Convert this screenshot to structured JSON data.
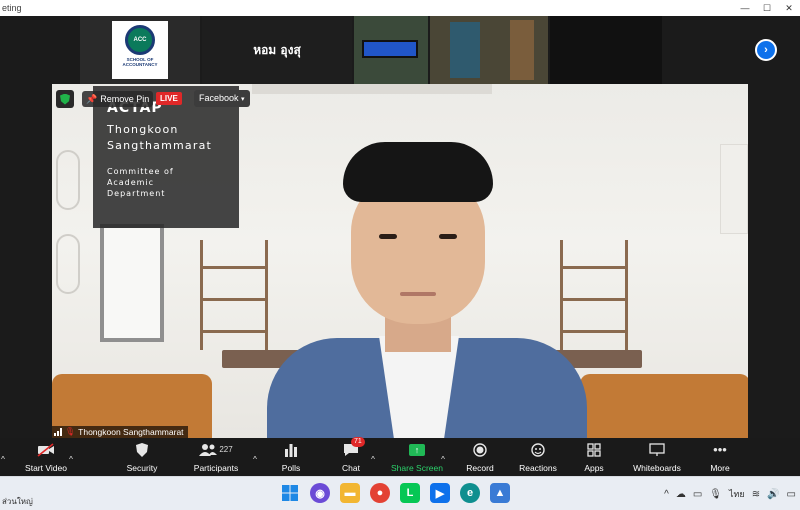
{
  "window": {
    "title": "eting"
  },
  "strip": {
    "name_tile": "หอม  อุงสุ",
    "logo_text": "ACC",
    "logo_caption": "SCHOOL OF ACCOUNTANCY"
  },
  "overlay": {
    "remove_pin": "Remove Pin",
    "live": "LIVE",
    "facebook": "Facebook"
  },
  "caption": {
    "org": "ACTAP",
    "name_line1": "Thongkoon",
    "name_line2": "Sangthammarat",
    "role_line1": "Committee of",
    "role_line2": "Academic",
    "role_line3": "Department"
  },
  "speaker": {
    "name": "Thongkoon Sangthammarat"
  },
  "toolbar": {
    "start_video": "Start Video",
    "security": "Security",
    "participants": "Participants",
    "participants_count": "227",
    "polls": "Polls",
    "chat": "Chat",
    "chat_badge": "71",
    "share_screen": "Share Screen",
    "record": "Record",
    "reactions": "Reactions",
    "apps": "Apps",
    "whiteboards": "Whiteboards",
    "more": "More"
  },
  "taskbar": {
    "weather_text": "ส่วนใหญ่",
    "language": "ไทย"
  },
  "colors": {
    "accent_blue": "#0e71eb",
    "share_green": "#20b956",
    "live_red": "#e02828",
    "suit_blue": "#4f6d9e"
  }
}
